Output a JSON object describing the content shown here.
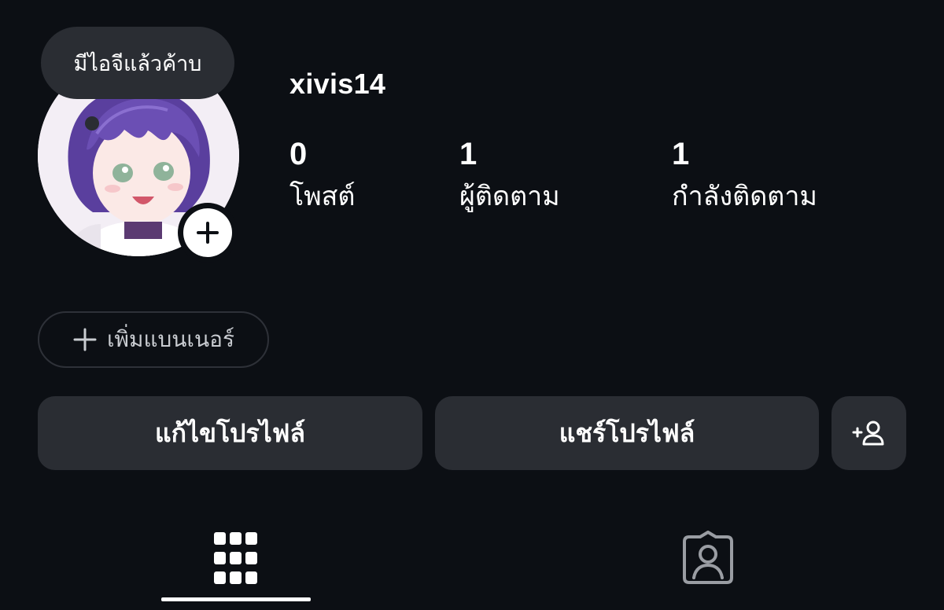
{
  "profile": {
    "username": "xivis14",
    "note": "มีไอจีแล้วค้าบ"
  },
  "stats": {
    "posts": {
      "value": "0",
      "label": "โพสต์"
    },
    "followers": {
      "value": "1",
      "label": "ผู้ติดตาม"
    },
    "following": {
      "value": "1",
      "label": "กำลังติดตาม"
    }
  },
  "banner": {
    "label": "เพิ่มแบนเนอร์",
    "icon": "plus-icon"
  },
  "actions": {
    "edit_profile": "แก้ไขโปรไฟล์",
    "share_profile": "แชร์โปรไฟล์",
    "add_person_icon": "add-person-icon"
  },
  "tabs": [
    {
      "icon": "grid-icon",
      "active": true
    },
    {
      "icon": "tagged-icon",
      "active": false
    }
  ],
  "colors": {
    "background": "#0c0f14",
    "button": "#2a2d33",
    "text": "#ffffff",
    "muted": "#c9ccd1"
  }
}
